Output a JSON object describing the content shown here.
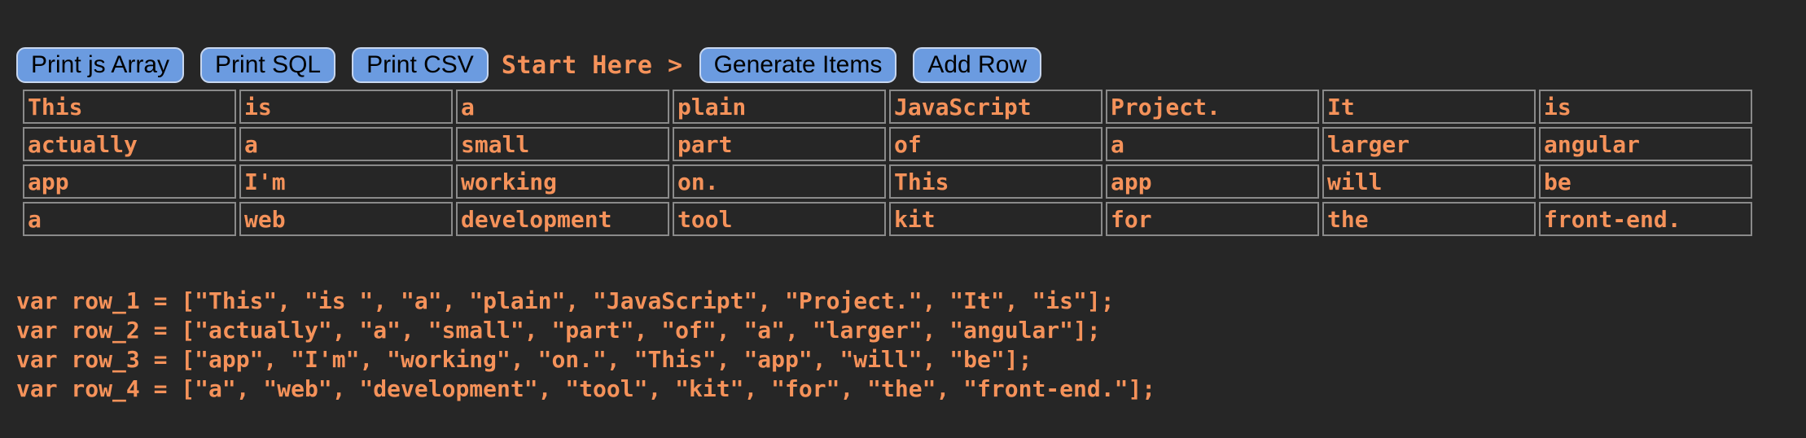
{
  "toolbar": {
    "print_js_label": "Print js Array",
    "print_sql_label": "Print SQL",
    "print_csv_label": "Print CSV",
    "start_label": "Start Here >",
    "generate_label": "Generate Items",
    "add_row_label": "Add Row"
  },
  "grid": {
    "rows": [
      [
        "This",
        "is",
        "a",
        "plain",
        "JavaScript",
        "Project.",
        "It",
        "is"
      ],
      [
        "actually",
        "a",
        "small",
        "part",
        "of",
        "a",
        "larger",
        "angular"
      ],
      [
        "app",
        "I'm",
        "working",
        "on.",
        "This",
        "app",
        "will",
        "be"
      ],
      [
        "a",
        "web",
        "development",
        "tool",
        "kit",
        "for",
        "the",
        "front-end."
      ]
    ]
  },
  "output": {
    "lines": [
      "var row_1 = [\"This\", \"is \", \"a\", \"plain\", \"JavaScript\", \"Project.\", \"It\", \"is\"];",
      "var row_2 = [\"actually\", \"a\", \"small\", \"part\", \"of\", \"a\", \"larger\", \"angular\"];",
      "var row_3 = [\"app\", \"I'm\", \"working\", \"on.\", \"This\", \"app\", \"will\", \"be\"];",
      "var row_4 = [\"a\", \"web\", \"development\", \"tool\", \"kit\", \"for\", \"the\", \"front-end.\"];"
    ]
  }
}
